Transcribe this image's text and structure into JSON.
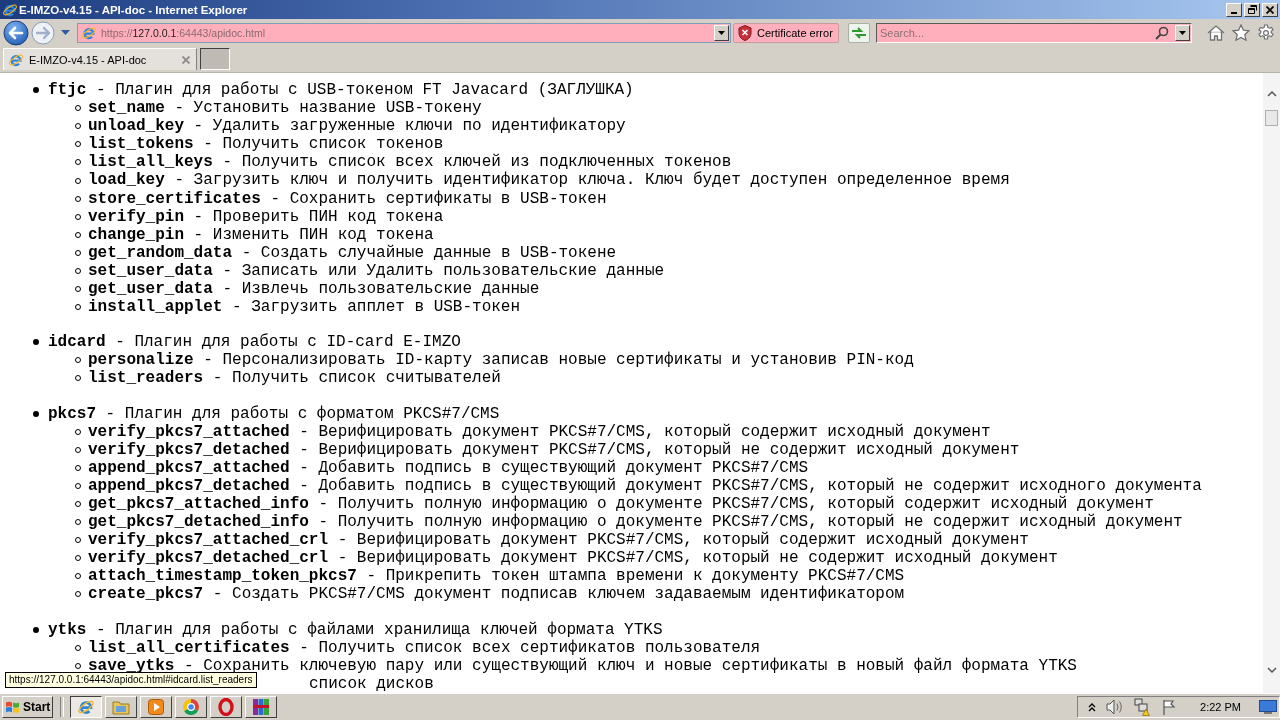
{
  "window": {
    "title": "E-IMZO-v4.15 - API-doc - Internet Explorer"
  },
  "address_bar": {
    "url": {
      "scheme": "https://",
      "host": "127.0.0.1",
      "path": ":64443/apidoc.html"
    },
    "certificate_error": "Certificate error"
  },
  "search": {
    "placeholder": "Search..."
  },
  "tabs": [
    {
      "label": "E-IMZO-v4.15 - API-doc",
      "selected": true
    }
  ],
  "plugins": [
    {
      "text": "**ftjc** - Плагин для работы с USB-токеном FT Javacard (ЗАГЛУШКА)",
      "methods": [
        "**set_name** - Установить название USB-токену",
        "**unload_key** - Удалить загруженные ключи по идентификатору",
        "**list_tokens** - Получить список токенов",
        "**list_all_keys** - Получить список всех ключей из подключенных токенов",
        "**load_key** - Загрузить ключ и получить идентификатор ключа. Ключ будет доступен определенное время",
        "**store_certificates** - Сохранить сертификаты в USB-токен",
        "**verify_pin** - Проверить ПИН код токена",
        "**change_pin** - Изменить ПИН код токена",
        "**get_random_data** - Создать случайные данные в USB-токене",
        "**set_user_data** - Записать или Удалить пользовательские данные",
        "**get_user_data** - Извлечь пользовательские данные",
        "**install_applet** - Загрузить апплет в USB-токен"
      ]
    },
    {
      "text": "**idcard** - Плагин для работы с ID-card E-IMZO",
      "methods": [
        "**personalize** - Персонализировать ID-карту записав новые сертификаты и установив PIN-код",
        "**list_readers** - Получить список считывателей"
      ]
    },
    {
      "text": "**pkcs7** - Плагин для работы с форматом PKCS#7/CMS",
      "methods": [
        "**verify_pkcs7_attached** - Верифицировать документ PKCS#7/CMS, который содержит исходный документ",
        "**verify_pkcs7_detached** - Верифицировать документ PKCS#7/CMS, который не содержит исходный документ",
        "**append_pkcs7_attached** - Добавить подпись в существующий документ PKCS#7/CMS",
        "**append_pkcs7_detached** - Добавить подпись в существующий документ PKCS#7/CMS, который не содержит исходного документа",
        "**get_pkcs7_attached_info** - Получить полную информацию о документе PKCS#7/CMS, который содержит исходный документ",
        "**get_pkcs7_detached_info** - Получить полную информацию о документе PKCS#7/CMS, который не содержит исходный документ",
        "**verify_pkcs7_attached_crl** - Верифицировать документ PKCS#7/CMS, который содержит исходный документ",
        "**verify_pkcs7_detached_crl** - Верифицировать документ PKCS#7/CMS, который не содержит исходный документ",
        "**attach_timestamp_token_pkcs7** - Прикрепить токен штампа времени к документу PKCS#7/CMS",
        "**create_pkcs7** - Создать PKCS#7/CMS документ подписав ключем задаваемым идентификатором"
      ]
    },
    {
      "text": "**ytks** - Плагин для работы с файлами хранилища ключей формата YTKS",
      "methods": [
        "**list_all_certificates** - Получить список всех сертификатов пользователя",
        "**save_ytks** - Сохранить ключевую пару или существующий ключ и новые сертификаты в новый файл формата YTKS"
      ],
      "covered_method": "список дисков"
    }
  ],
  "status_tooltip": "https://127.0.0.1:64443/apidoc.html#idcard.list_readers",
  "taskbar": {
    "start": "Start",
    "buttons": [
      {
        "selected": true
      },
      {
        "selected": false
      },
      {
        "selected": false
      },
      {
        "selected": false
      },
      {
        "selected": false
      },
      {
        "selected": false
      }
    ],
    "clock": "2:22 PM"
  }
}
